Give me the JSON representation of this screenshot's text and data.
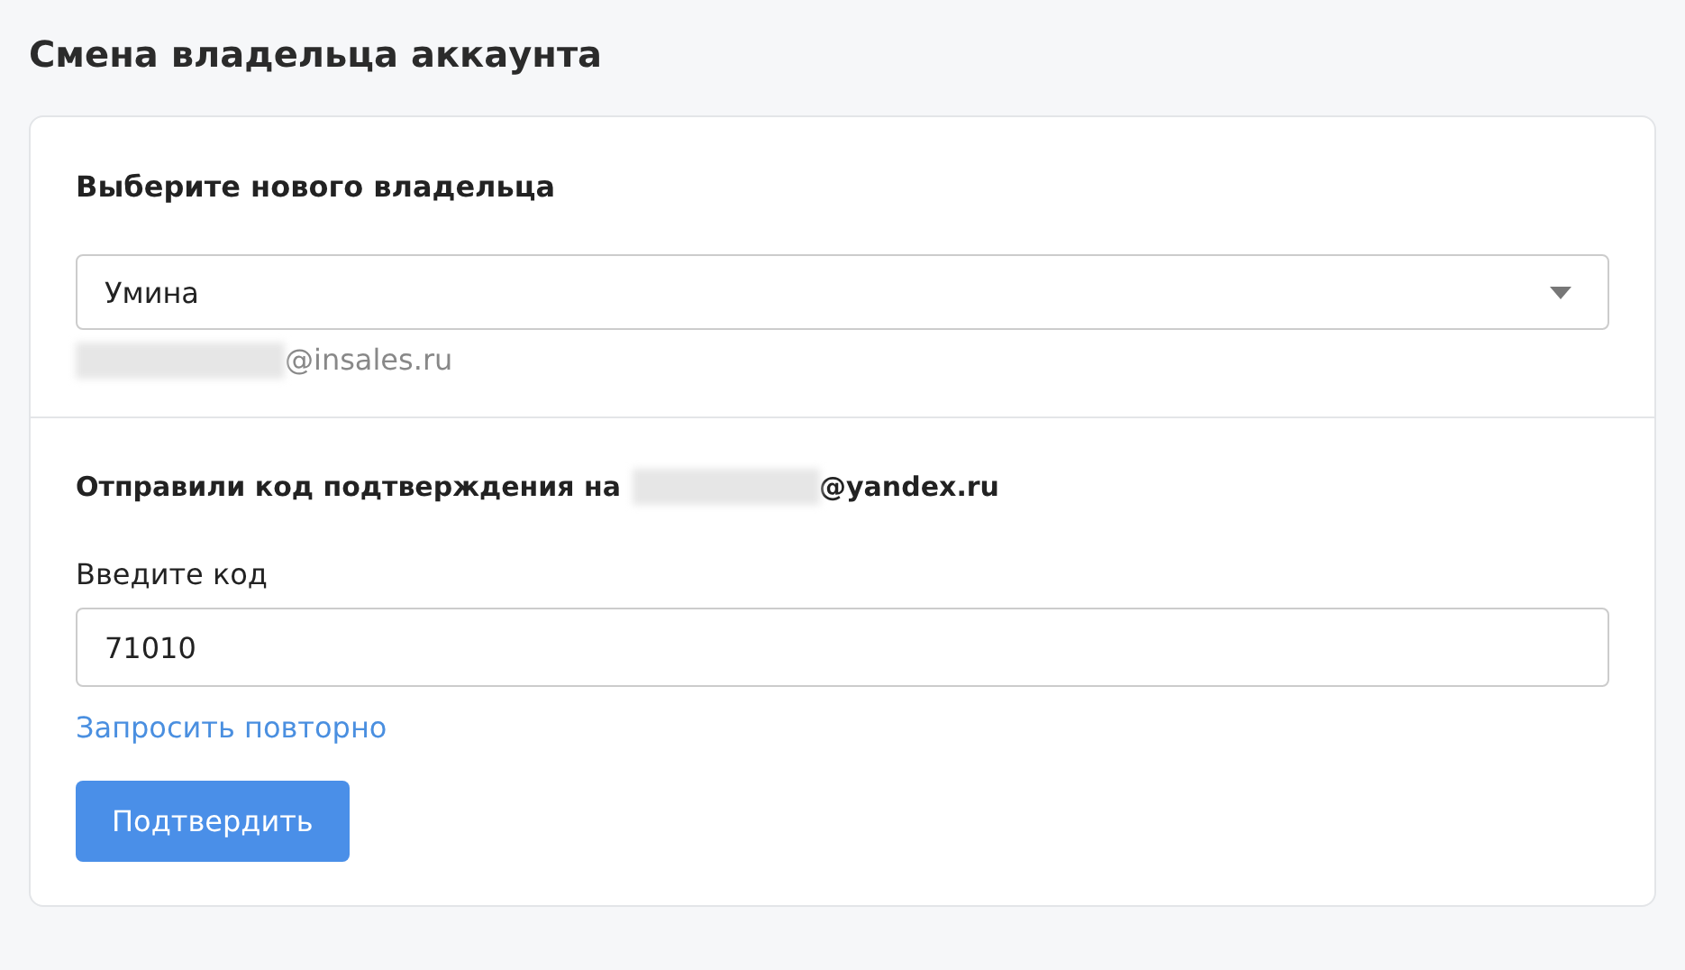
{
  "page_title": "Смена владельца аккаунта",
  "owner_section": {
    "heading": "Выберите нового владельца",
    "select": {
      "value": "Умина"
    },
    "email_domain": "@insales.ru"
  },
  "confirm_section": {
    "sent_text": "Отправили код подтверждения на",
    "email_domain": "@yandex.ru",
    "code_label": "Введите код",
    "code_value": "71010",
    "resend_link": "Запросить повторно",
    "submit_button": "Подтвердить"
  }
}
